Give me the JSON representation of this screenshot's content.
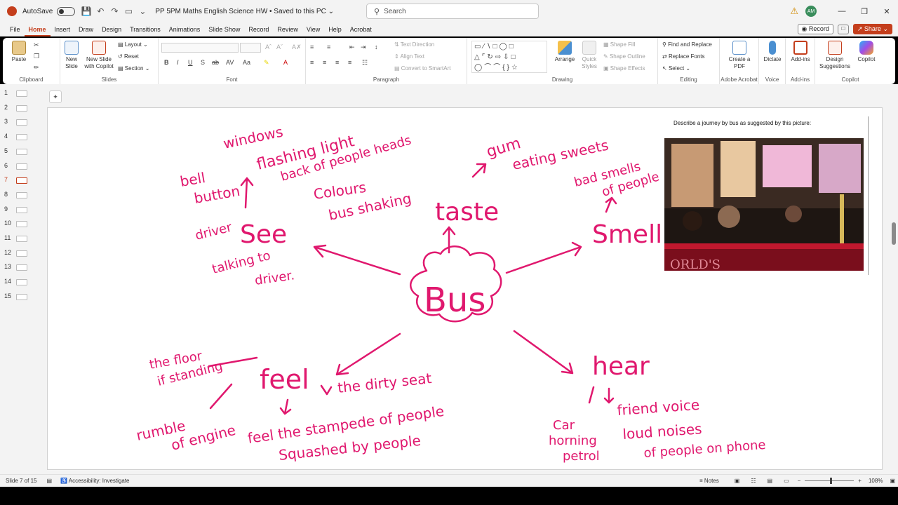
{
  "titlebar": {
    "autosave_label": "AutoSave",
    "doc_title": "PP 5PM Maths English Science HW  •  Saved to this PC ⌄",
    "search_placeholder": "Search",
    "avatar_initials": "AM"
  },
  "menu": {
    "items": [
      "File",
      "Home",
      "Insert",
      "Draw",
      "Design",
      "Transitions",
      "Animations",
      "Slide Show",
      "Record",
      "Review",
      "View",
      "Help",
      "Acrobat"
    ],
    "record_label": "Record",
    "share_label": "Share"
  },
  "ribbon": {
    "clipboard": {
      "paste": "Paste",
      "label": "Clipboard"
    },
    "slides": {
      "new_slide": "New Slide",
      "new_slide_copilot": "New Slide with Copilot",
      "layout": "Layout",
      "reset": "Reset",
      "section": "Section",
      "label": "Slides"
    },
    "font": {
      "label": "Font"
    },
    "paragraph": {
      "text_direction": "Text Direction",
      "align_text": "Align Text",
      "convert_smartart": "Convert to SmartArt",
      "label": "Paragraph"
    },
    "drawing": {
      "arrange": "Arrange",
      "quick_styles": "Quick Styles",
      "shape_fill": "Shape Fill",
      "shape_outline": "Shape Outline",
      "shape_effects": "Shape Effects",
      "label": "Drawing"
    },
    "editing": {
      "find_replace": "Find and Replace",
      "replace_fonts": "Replace Fonts",
      "select": "Select",
      "label": "Editing"
    },
    "acrobat": {
      "create_pdf": "Create a PDF",
      "label": "Adobe Acrobat"
    },
    "voice": {
      "dictate": "Dictate",
      "label": "Voice"
    },
    "addins": {
      "addins": "Add-ins",
      "label": "Add-ins"
    },
    "copilot": {
      "design_suggestions": "Design Suggestions",
      "copilot": "Copilot",
      "label": "Copilot"
    }
  },
  "thumbnails": [
    "1",
    "2",
    "3",
    "4",
    "5",
    "6",
    "7",
    "8",
    "9",
    "10",
    "11",
    "12",
    "13",
    "14",
    "15"
  ],
  "active_slide_index": 6,
  "slide": {
    "caption": "Describe a journey by bus as suggested by this picture:",
    "photo_text": "ORLD'S",
    "handwriting": {
      "center": "Bus",
      "see": "See",
      "taste": "taste",
      "smell": "Smell",
      "feel": "feel",
      "hear": "hear",
      "windows": "windows",
      "flashing_light": "flashing light",
      "back_of_heads": "back of people heads",
      "colours": "Colours",
      "bus_shaking": "bus shaking",
      "bell": "bell",
      "button": "button",
      "driver": "driver",
      "talking_to": "talking to",
      "driver2": "driver.",
      "gum": "gum",
      "eating_sweets": "eating sweets",
      "bad_smells": "bad smells",
      "of_people": "of people",
      "the_floor": "the floor",
      "if_standing": "if standing",
      "dirty_seat": "the dirty seat",
      "rumble": "rumble",
      "of_engine": "of engine",
      "stampede": "feel the stampede of people",
      "squashed": "Squashed by people",
      "friend_voice": "friend voice",
      "loud_noises": "loud noises",
      "people_phone": "of people on phone",
      "car": "Car",
      "horning": "horning",
      "petrol": "petrol"
    }
  },
  "status": {
    "slide_of": "Slide 7 of 15",
    "accessibility": "Accessibility: Investigate",
    "notes": "Notes",
    "zoom": "108%"
  },
  "colors": {
    "accent": "#c43e1c",
    "ink": "#e0186e"
  }
}
